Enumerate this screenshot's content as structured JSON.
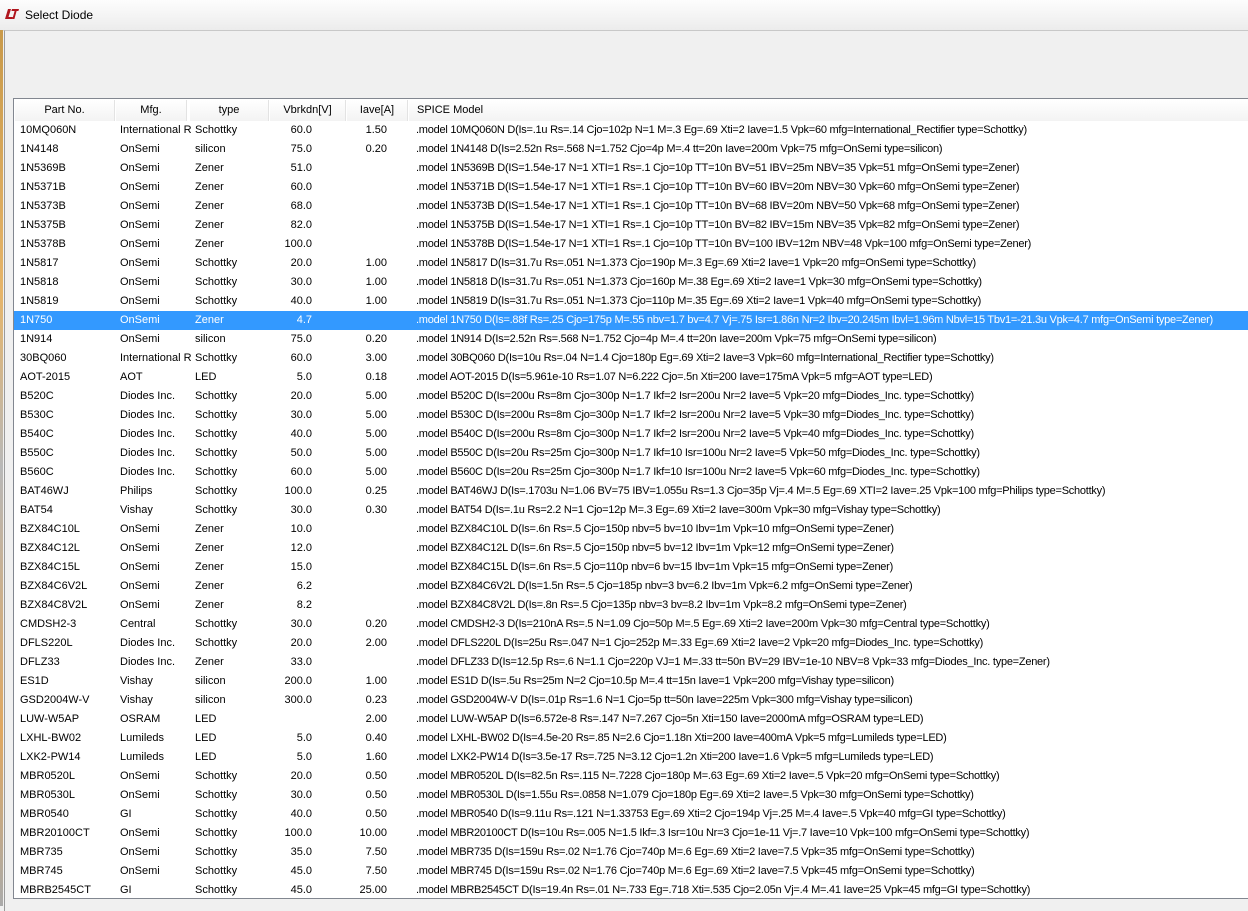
{
  "window": {
    "title": "Select Diode",
    "accent": "#3399ff"
  },
  "columns": [
    "Part No.",
    "Mfg.",
    "type",
    "Vbrkdn[V]",
    "Iave[A]",
    "SPICE Model"
  ],
  "selected_index": 10,
  "rows": [
    [
      "10MQ060N",
      "International R",
      "Schottky",
      "60.0",
      "1.50",
      ".model 10MQ060N D(Is=.1u Rs=.14 Cjo=102p N=1 M=.3 Eg=.69 Xti=2 Iave=1.5 Vpk=60 mfg=International_Rectifier type=Schottky)"
    ],
    [
      "1N4148",
      "OnSemi",
      "silicon",
      "75.0",
      "0.20",
      ".model 1N4148 D(Is=2.52n Rs=.568 N=1.752 Cjo=4p M=.4 tt=20n Iave=200m Vpk=75 mfg=OnSemi type=silicon)"
    ],
    [
      "1N5369B",
      "OnSemi",
      "Zener",
      "51.0",
      "",
      ".model 1N5369B D(IS=1.54e-17 N=1 XTI=1 Rs=.1 Cjo=10p TT=10n BV=51 IBV=25m NBV=35 Vpk=51 mfg=OnSemi type=Zener)"
    ],
    [
      "1N5371B",
      "OnSemi",
      "Zener",
      "60.0",
      "",
      ".model 1N5371B D(IS=1.54e-17 N=1 XTI=1 Rs=.1 Cjo=10p TT=10n BV=60 IBV=20m NBV=30 Vpk=60 mfg=OnSemi type=Zener)"
    ],
    [
      "1N5373B",
      "OnSemi",
      "Zener",
      "68.0",
      "",
      ".model 1N5373B D(IS=1.54e-17 N=1 XTI=1 Rs=.1 Cjo=10p TT=10n BV=68 IBV=20m NBV=50 Vpk=68 mfg=OnSemi type=Zener)"
    ],
    [
      "1N5375B",
      "OnSemi",
      "Zener",
      "82.0",
      "",
      ".model 1N5375B D(IS=1.54e-17 N=1 XTI=1 Rs=.1 Cjo=10p TT=10n BV=82 IBV=15m NBV=35 Vpk=82 mfg=OnSemi type=Zener)"
    ],
    [
      "1N5378B",
      "OnSemi",
      "Zener",
      "100.0",
      "",
      ".model 1N5378B D(IS=1.54e-17 N=1 XTI=1 Rs=.1 Cjo=10p TT=10n BV=100 IBV=12m NBV=48 Vpk=100 mfg=OnSemi type=Zener)"
    ],
    [
      "1N5817",
      "OnSemi",
      "Schottky",
      "20.0",
      "1.00",
      ".model 1N5817 D(Is=31.7u Rs=.051 N=1.373 Cjo=190p M=.3 Eg=.69 Xti=2 Iave=1 Vpk=20 mfg=OnSemi type=Schottky)"
    ],
    [
      "1N5818",
      "OnSemi",
      "Schottky",
      "30.0",
      "1.00",
      ".model 1N5818 D(Is=31.7u Rs=.051 N=1.373 Cjo=160p M=.38 Eg=.69 Xti=2 Iave=1 Vpk=30 mfg=OnSemi type=Schottky)"
    ],
    [
      "1N5819",
      "OnSemi",
      "Schottky",
      "40.0",
      "1.00",
      ".model 1N5819 D(Is=31.7u Rs=.051 N=1.373 Cjo=110p M=.35 Eg=.69 Xti=2 Iave=1 Vpk=40 mfg=OnSemi type=Schottky)"
    ],
    [
      "1N750",
      "OnSemi",
      "Zener",
      "4.7",
      "",
      ".model 1N750 D(Is=.88f Rs=.25 Cjo=175p M=.55 nbv=1.7 bv=4.7 Vj=.75 Isr=1.86n Nr=2 Ibv=20.245m Ibvl=1.96m Nbvl=15 Tbv1=-21.3u Vpk=4.7 mfg=OnSemi type=Zener)"
    ],
    [
      "1N914",
      "OnSemi",
      "silicon",
      "75.0",
      "0.20",
      ".model 1N914 D(Is=2.52n Rs=.568 N=1.752 Cjo=4p M=.4 tt=20n Iave=200m Vpk=75 mfg=OnSemi type=silicon)"
    ],
    [
      "30BQ060",
      "International R",
      "Schottky",
      "60.0",
      "3.00",
      ".model 30BQ060 D(Is=10u Rs=.04 N=1.4 Cjo=180p Eg=.69 Xti=2 Iave=3 Vpk=60 mfg=International_Rectifier type=Schottky)"
    ],
    [
      "AOT-2015",
      "AOT",
      "LED",
      "5.0",
      "0.18",
      ".model AOT-2015 D(Is=5.961e-10 Rs=1.07 N=6.222 Cjo=.5n Xti=200 Iave=175mA Vpk=5 mfg=AOT type=LED)"
    ],
    [
      "B520C",
      "Diodes Inc.",
      "Schottky",
      "20.0",
      "5.00",
      ".model B520C D(Is=200u Rs=8m Cjo=300p N=1.7 Ikf=2 Isr=200u Nr=2 Iave=5 Vpk=20 mfg=Diodes_Inc. type=Schottky)"
    ],
    [
      "B530C",
      "Diodes Inc.",
      "Schottky",
      "30.0",
      "5.00",
      ".model B530C D(Is=200u Rs=8m Cjo=300p N=1.7 Ikf=2 Isr=200u Nr=2 Iave=5 Vpk=30 mfg=Diodes_Inc. type=Schottky)"
    ],
    [
      "B540C",
      "Diodes Inc.",
      "Schottky",
      "40.0",
      "5.00",
      ".model B540C D(Is=200u Rs=8m Cjo=300p N=1.7 Ikf=2 Isr=200u Nr=2 Iave=5 Vpk=40 mfg=Diodes_Inc. type=Schottky)"
    ],
    [
      "B550C",
      "Diodes Inc.",
      "Schottky",
      "50.0",
      "5.00",
      ".model B550C D(Is=20u Rs=25m Cjo=300p N=1.7 Ikf=10 Isr=100u Nr=2 Iave=5 Vpk=50 mfg=Diodes_Inc. type=Schottky)"
    ],
    [
      "B560C",
      "Diodes Inc.",
      "Schottky",
      "60.0",
      "5.00",
      ".model B560C D(Is=20u Rs=25m Cjo=300p N=1.7 Ikf=10 Isr=100u Nr=2 Iave=5 Vpk=60 mfg=Diodes_Inc. type=Schottky)"
    ],
    [
      "BAT46WJ",
      "Philips",
      "Schottky",
      "100.0",
      "0.25",
      ".model BAT46WJ D(Is=.1703u N=1.06 BV=75 IBV=1.055u Rs=1.3 Cjo=35p Vj=.4 M=.5 Eg=.69 XTI=2 Iave=.25 Vpk=100 mfg=Philips type=Schottky)"
    ],
    [
      "BAT54",
      "Vishay",
      "Schottky",
      "30.0",
      "0.30",
      ".model BAT54 D(Is=.1u Rs=2.2 N=1 Cjo=12p M=.3 Eg=.69 Xti=2 Iave=300m Vpk=30 mfg=Vishay type=Schottky)"
    ],
    [
      "BZX84C10L",
      "OnSemi",
      "Zener",
      "10.0",
      "",
      ".model BZX84C10L D(Is=.6n Rs=.5 Cjo=150p nbv=5 bv=10 Ibv=1m Vpk=10 mfg=OnSemi type=Zener)"
    ],
    [
      "BZX84C12L",
      "OnSemi",
      "Zener",
      "12.0",
      "",
      ".model BZX84C12L D(Is=.6n Rs=.5 Cjo=150p nbv=5 bv=12 Ibv=1m Vpk=12 mfg=OnSemi type=Zener)"
    ],
    [
      "BZX84C15L",
      "OnSemi",
      "Zener",
      "15.0",
      "",
      ".model BZX84C15L D(Is=.6n Rs=.5 Cjo=110p nbv=6 bv=15 Ibv=1m Vpk=15 mfg=OnSemi type=Zener)"
    ],
    [
      "BZX84C6V2L",
      "OnSemi",
      "Zener",
      "6.2",
      "",
      ".model BZX84C6V2L D(Is=1.5n Rs=.5 Cjo=185p nbv=3 bv=6.2 Ibv=1m Vpk=6.2 mfg=OnSemi type=Zener)"
    ],
    [
      "BZX84C8V2L",
      "OnSemi",
      "Zener",
      "8.2",
      "",
      ".model BZX84C8V2L D(Is=.8n Rs=.5 Cjo=135p nbv=3 bv=8.2 Ibv=1m Vpk=8.2 mfg=OnSemi type=Zener)"
    ],
    [
      "CMDSH2-3",
      "Central",
      "Schottky",
      "30.0",
      "0.20",
      ".model CMDSH2-3 D(Is=210nA Rs=.5 N=1.09 Cjo=50p M=.5 Eg=.69 Xti=2 Iave=200m Vpk=30 mfg=Central type=Schottky)"
    ],
    [
      "DFLS220L",
      "Diodes Inc.",
      "Schottky",
      "20.0",
      "2.00",
      ".model DFLS220L D(Is=25u Rs=.047 N=1 Cjo=252p M=.33 Eg=.69 Xti=2 Iave=2 Vpk=20 mfg=Diodes_Inc. type=Schottky)"
    ],
    [
      "DFLZ33",
      "Diodes Inc.",
      "Zener",
      "33.0",
      "",
      ".model DFLZ33 D(Is=12.5p Rs=.6 N=1.1 Cjo=220p VJ=1 M=.33 tt=50n BV=29 IBV=1e-10 NBV=8 Vpk=33 mfg=Diodes_Inc. type=Zener)"
    ],
    [
      "ES1D",
      "Vishay",
      "silicon",
      "200.0",
      "1.00",
      ".model ES1D D(Is=.5u Rs=25m N=2 Cjo=10.5p M=.4 tt=15n Iave=1 Vpk=200 mfg=Vishay type=silicon)"
    ],
    [
      "GSD2004W-V",
      "Vishay",
      "silicon",
      "300.0",
      "0.23",
      ".model GSD2004W-V D(Is=.01p Rs=1.6 N=1 Cjo=5p tt=50n Iave=225m Vpk=300 mfg=Vishay type=silicon)"
    ],
    [
      "LUW-W5AP",
      "OSRAM",
      "LED",
      "",
      "2.00",
      ".model LUW-W5AP D(Is=6.572e-8 Rs=.147 N=7.267 Cjo=5n Xti=150 Iave=2000mA mfg=OSRAM type=LED)"
    ],
    [
      "LXHL-BW02",
      "Lumileds",
      "LED",
      "5.0",
      "0.40",
      ".model LXHL-BW02 D(Is=4.5e-20 Rs=.85 N=2.6 Cjo=1.18n Xti=200 Iave=400mA Vpk=5 mfg=Lumileds type=LED)"
    ],
    [
      "LXK2-PW14",
      "Lumileds",
      "LED",
      "5.0",
      "1.60",
      ".model LXK2-PW14 D(Is=3.5e-17 Rs=.725 N=3.12 Cjo=1.2n Xti=200 Iave=1.6 Vpk=5 mfg=Lumileds type=LED)"
    ],
    [
      "MBR0520L",
      "OnSemi",
      "Schottky",
      "20.0",
      "0.50",
      ".model MBR0520L D(Is=82.5n Rs=.115 N=.7228 Cjo=180p M=.63 Eg=.69 Xti=2 Iave=.5 Vpk=20 mfg=OnSemi type=Schottky)"
    ],
    [
      "MBR0530L",
      "OnSemi",
      "Schottky",
      "30.0",
      "0.50",
      ".model MBR0530L D(Is=1.55u Rs=.0858 N=1.079 Cjo=180p Eg=.69 Xti=2 Iave=.5 Vpk=30 mfg=OnSemi type=Schottky)"
    ],
    [
      "MBR0540",
      "GI",
      "Schottky",
      "40.0",
      "0.50",
      ".model MBR0540 D(Is=9.11u Rs=.121 N=1.33753 Eg=.69 Xti=2 Cjo=194p Vj=.25 M=.4 Iave=.5 Vpk=40 mfg=GI type=Schottky)"
    ],
    [
      "MBR20100CT",
      "OnSemi",
      "Schottky",
      "100.0",
      "10.00",
      ".model MBR20100CT D(Is=10u Rs=.005 N=1.5 Ikf=.3 Isr=10u Nr=3 Cjo=1e-11 Vj=.7 Iave=10 Vpk=100 mfg=OnSemi type=Schottky)"
    ],
    [
      "MBR735",
      "OnSemi",
      "Schottky",
      "35.0",
      "7.50",
      ".model MBR735 D(Is=159u Rs=.02 N=1.76 Cjo=740p M=.6 Eg=.69 Xti=2 Iave=7.5 Vpk=35 mfg=OnSemi type=Schottky)"
    ],
    [
      "MBR745",
      "OnSemi",
      "Schottky",
      "45.0",
      "7.50",
      ".model MBR745 D(Is=159u Rs=.02 N=1.76 Cjo=740p M=.6 Eg=.69 Xti=2 Iave=7.5 Vpk=45 mfg=OnSemi type=Schottky)"
    ],
    [
      "MBRB2545CT",
      "GI",
      "Schottky",
      "45.0",
      "25.00",
      ".model MBRB2545CT D(Is=19.4n Rs=.01 N=.733 Eg=.718 Xti=.535 Cjo=2.05n Vj=.4 M=.41 Iave=25 Vpk=45 mfg=GI type=Schottky)"
    ]
  ]
}
